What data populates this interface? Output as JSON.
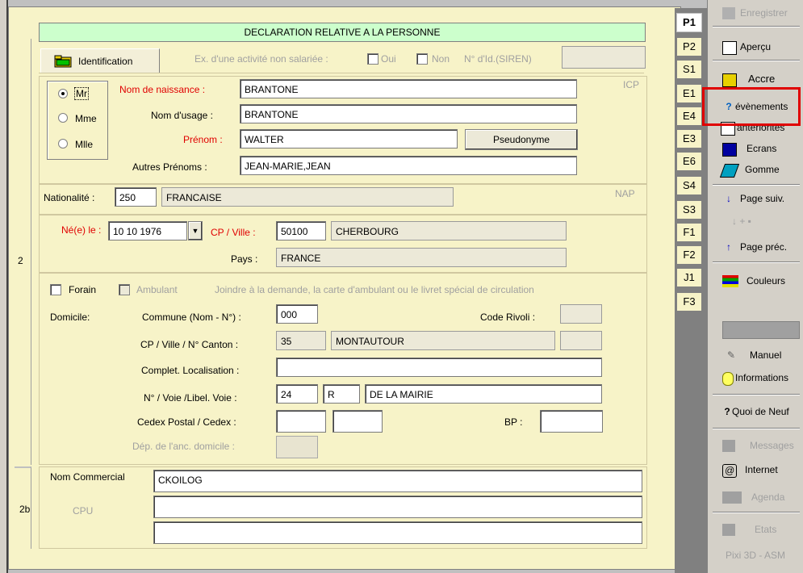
{
  "form": {
    "title": "DECLARATION RELATIVE A LA PERSONNE",
    "tab_identification": "Identification",
    "non_salaried_label": "Ex. d'une activité non salariée :",
    "oui": "Oui",
    "non": "Non",
    "siren_label": "N° d'Id.(SIREN)",
    "siren_value": "",
    "icp": "ICP",
    "nap": "NAP",
    "section_num_2": "2",
    "section_num_2b": "2b"
  },
  "identity": {
    "civility": [
      {
        "label": "Mr",
        "selected": true
      },
      {
        "label": "Mme",
        "selected": false
      },
      {
        "label": "Mlle",
        "selected": false
      }
    ],
    "nom_naissance_label": "Nom de naissance :",
    "nom_naissance": "BRANTONE",
    "nom_usage_label": "Nom d'usage :",
    "nom_usage": "BRANTONE",
    "prenom_label": "Prénom :",
    "prenom": "WALTER",
    "pseudonyme_button": "Pseudonyme",
    "autres_prenoms_label": "Autres Prénoms :",
    "autres_prenoms": "JEAN-MARIE,JEAN"
  },
  "nationality": {
    "label": "Nationalité :",
    "code": "250",
    "name": "FRANCAISE"
  },
  "birth": {
    "ne_le_label": "Né(e) le :",
    "date": "10 10 1976",
    "cp_ville_label": "CP / Ville :",
    "cp": "50100",
    "ville": "CHERBOURG",
    "pays_label": "Pays :",
    "pays": "FRANCE"
  },
  "domicile": {
    "forain": "Forain",
    "ambulant": "Ambulant",
    "notice": "Joindre à la demande, la carte d'ambulant ou le livret spécial de circulation",
    "domicile_label": "Domicile:",
    "commune_label": "Commune (Nom - N°) :",
    "commune": "000",
    "code_rivoli_label": "Code Rivoli :",
    "code_rivoli": "",
    "cp_ville_canton_label": "CP / Ville / N° Canton :",
    "cp": "35",
    "ville": "MONTAUTOUR",
    "canton": "",
    "complet_label": "Complet. Localisation :",
    "complet": "",
    "voie_label": "N° / Voie /Libel. Voie :",
    "numero": "24",
    "voie": "R",
    "libelle": "DE LA MAIRIE",
    "cedex_label": "Cedex Postal / Cedex :",
    "cedex_postal": "",
    "cedex": "",
    "bp_label": "BP :",
    "bp": "",
    "dep_label": "Dép. de l'anc. domicile :",
    "dep": ""
  },
  "commercial": {
    "nom_commercial_label": "Nom Commercial",
    "nom_commercial": "CKOILOG",
    "cpu_label": "CPU",
    "line2": "",
    "line3": ""
  },
  "vtabs": [
    "P1",
    "P2",
    "S1",
    "E1",
    "E4",
    "E3",
    "E6",
    "S4",
    "S3",
    "F1",
    "F2",
    "J1",
    "F3"
  ],
  "toolbar": {
    "enregistrer": "Enregistrer",
    "apercu": "Aperçu",
    "accre": "Accre",
    "evenements": "évènements",
    "anteriorites": "antériorités",
    "ecrans": "Ecrans",
    "gomme": "Gomme",
    "page_suiv": "Page suiv.",
    "page_prec": "Page préc.",
    "couleurs": "Couleurs",
    "manuel": "Manuel",
    "informations": "Informations",
    "quoi_de_neuf": "Quoi de Neuf",
    "messages": "Messages",
    "internet": "Internet",
    "agenda": "Agenda",
    "etats": "Etats",
    "footer": "Pixi 3D - ASM"
  },
  "colors": {
    "form_bg": "#f7f3c8",
    "title_bg": "#ccffcc",
    "label_red": "#e00000",
    "highlight": "#e00000"
  }
}
